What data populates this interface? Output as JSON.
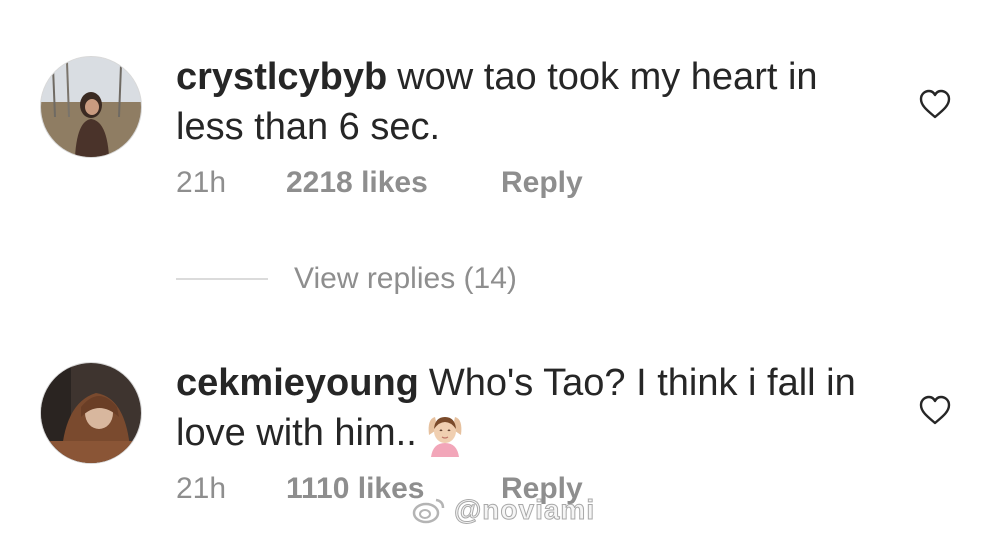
{
  "comments": [
    {
      "username": "crystlcybyb",
      "text": "wow tao took my heart in less than 6 sec.",
      "time": "21h",
      "likes": "2218 likes",
      "reply": "Reply",
      "avatar_icon": "profile-photo-outdoor"
    },
    {
      "username": "cekmieyoung",
      "text": "Who's Tao? I think i fall in love with him..",
      "emoji": "person-gesturing-ok-emoji",
      "time": "21h",
      "likes": "1110 likes",
      "reply": "Reply",
      "avatar_icon": "profile-photo-hijab"
    }
  ],
  "view_replies": "View replies (14)",
  "watermark": "@noviami",
  "colors": {
    "text": "#262626",
    "secondary": "#8e8e8e",
    "divider": "#dbdbdb"
  }
}
